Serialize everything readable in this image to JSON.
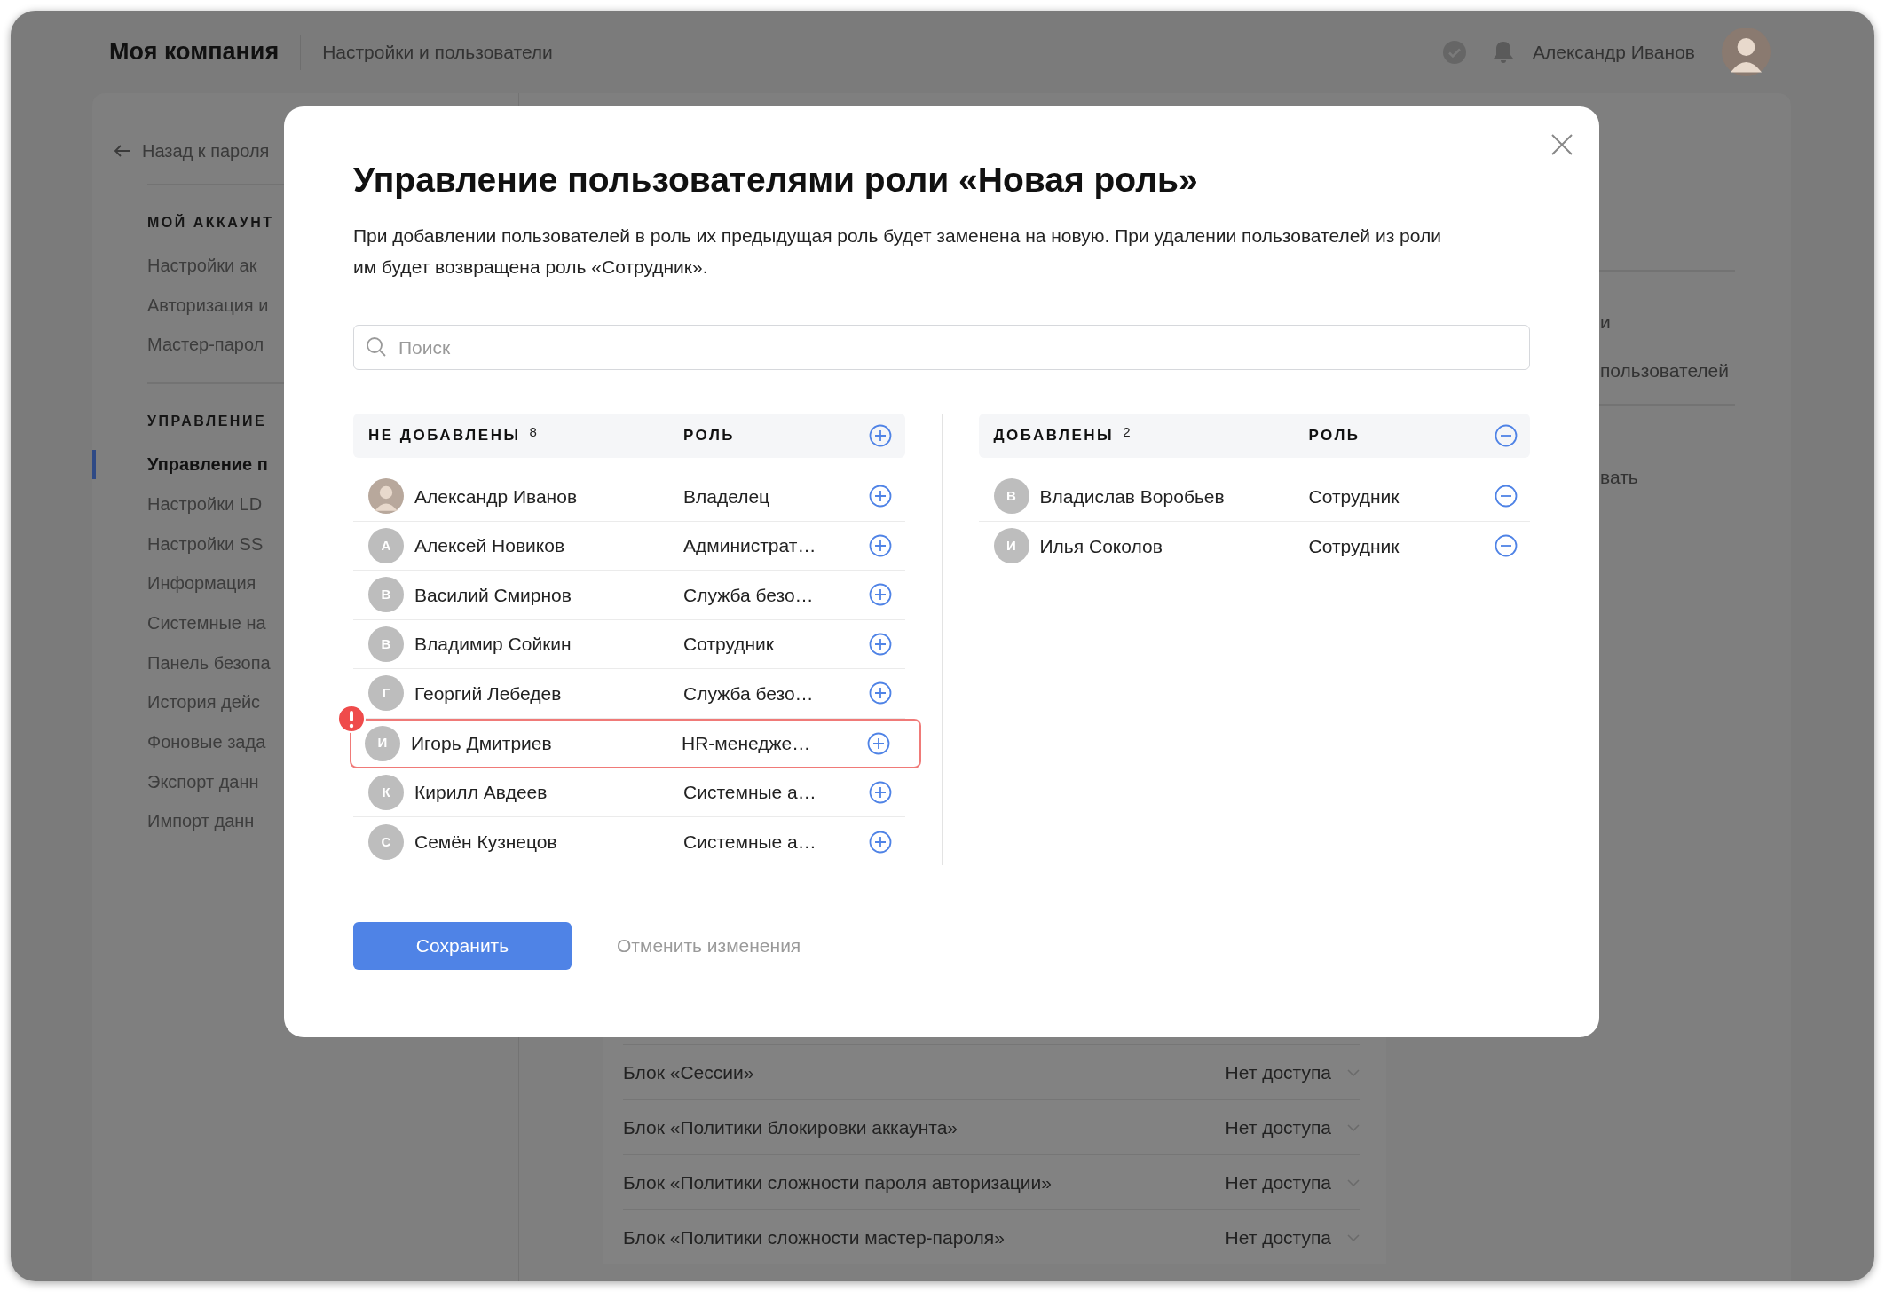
{
  "topbar": {
    "company": "Моя компания",
    "section": "Настройки и пользователи",
    "user_name": "Александр Иванов"
  },
  "sidebar": {
    "back_link": "Назад к пароля",
    "groups": [
      {
        "title": "МОЙ АККАУНТ",
        "items": [
          {
            "label": "Настройки ак",
            "selected": false
          },
          {
            "label": "Авторизация и",
            "selected": false
          },
          {
            "label": "Мастер-парол",
            "selected": false
          }
        ]
      },
      {
        "title": "УПРАВЛЕНИЕ",
        "items": [
          {
            "label": "Управление п",
            "selected": true
          },
          {
            "label": "Настройки LD",
            "selected": false
          },
          {
            "label": "Настройки SS",
            "selected": false
          },
          {
            "label": "Информация",
            "selected": false
          },
          {
            "label": "Системные на",
            "selected": false
          },
          {
            "label": "Панель безопа",
            "selected": false
          },
          {
            "label": "История дейс",
            "selected": false
          },
          {
            "label": "Фоновые зада",
            "selected": false
          },
          {
            "label": "Экспорт данн",
            "selected": false
          },
          {
            "label": "Импорт данн",
            "selected": false
          }
        ]
      }
    ]
  },
  "right_panel": {
    "texts": [
      "и",
      "пользователей",
      "вать"
    ]
  },
  "permissions": {
    "rows": [
      {
        "label": "Блок «Сессии»",
        "access": "Нет доступа"
      },
      {
        "label": "Блок «Политики блокировки аккаунта»",
        "access": "Нет доступа"
      },
      {
        "label": "Блок «Политики сложности пароля авторизации»",
        "access": "Нет доступа"
      },
      {
        "label": "Блок «Политики сложности мастер-пароля»",
        "access": "Нет доступа"
      }
    ]
  },
  "modal": {
    "title": "Управление пользователями роли «Новая роль»",
    "description": "При добавлении пользователей в роль их предыдущая роль будет заменена на новую. При удалении пользователей из роли им будет возвращена роль «Сотрудник».",
    "search": {
      "placeholder": "Поиск"
    },
    "not_added": {
      "title": "НЕ ДОБАВЛЕНЫ",
      "count": "8",
      "role_heading": "РОЛЬ",
      "users": [
        {
          "kind": "photo",
          "name": "Александр Иванов",
          "role": "Владелец",
          "error": false
        },
        {
          "kind": "initial",
          "initial": "А",
          "name": "Алексей Новиков",
          "role": "Администрат…",
          "error": false
        },
        {
          "kind": "initial",
          "initial": "В",
          "name": "Василий Смирнов",
          "role": "Служба безо…",
          "error": false
        },
        {
          "kind": "initial",
          "initial": "В",
          "name": "Владимир Сойкин",
          "role": "Сотрудник",
          "error": false
        },
        {
          "kind": "initial",
          "initial": "Г",
          "name": "Георгий Лебедев",
          "role": "Служба безо…",
          "error": false
        },
        {
          "kind": "initial",
          "initial": "И",
          "name": "Игорь Дмитриев",
          "role": "HR-менедже…",
          "error": true
        },
        {
          "kind": "initial",
          "initial": "К",
          "name": "Кирилл Авдеев",
          "role": "Системные а…",
          "error": false
        },
        {
          "kind": "initial",
          "initial": "С",
          "name": "Семён Кузнецов",
          "role": "Системные а…",
          "error": false
        }
      ]
    },
    "added": {
      "title": "ДОБАВЛЕНЫ",
      "count": "2",
      "role_heading": "РОЛЬ",
      "users": [
        {
          "kind": "initial",
          "initial": "В",
          "name": "Владислав Воробьев",
          "role": "Сотрудник",
          "error": false
        },
        {
          "kind": "initial",
          "initial": "И",
          "name": "Илья Соколов",
          "role": "Сотрудник",
          "error": false
        }
      ]
    },
    "buttons": {
      "save": "Сохранить",
      "cancel": "Отменить изменения"
    }
  }
}
